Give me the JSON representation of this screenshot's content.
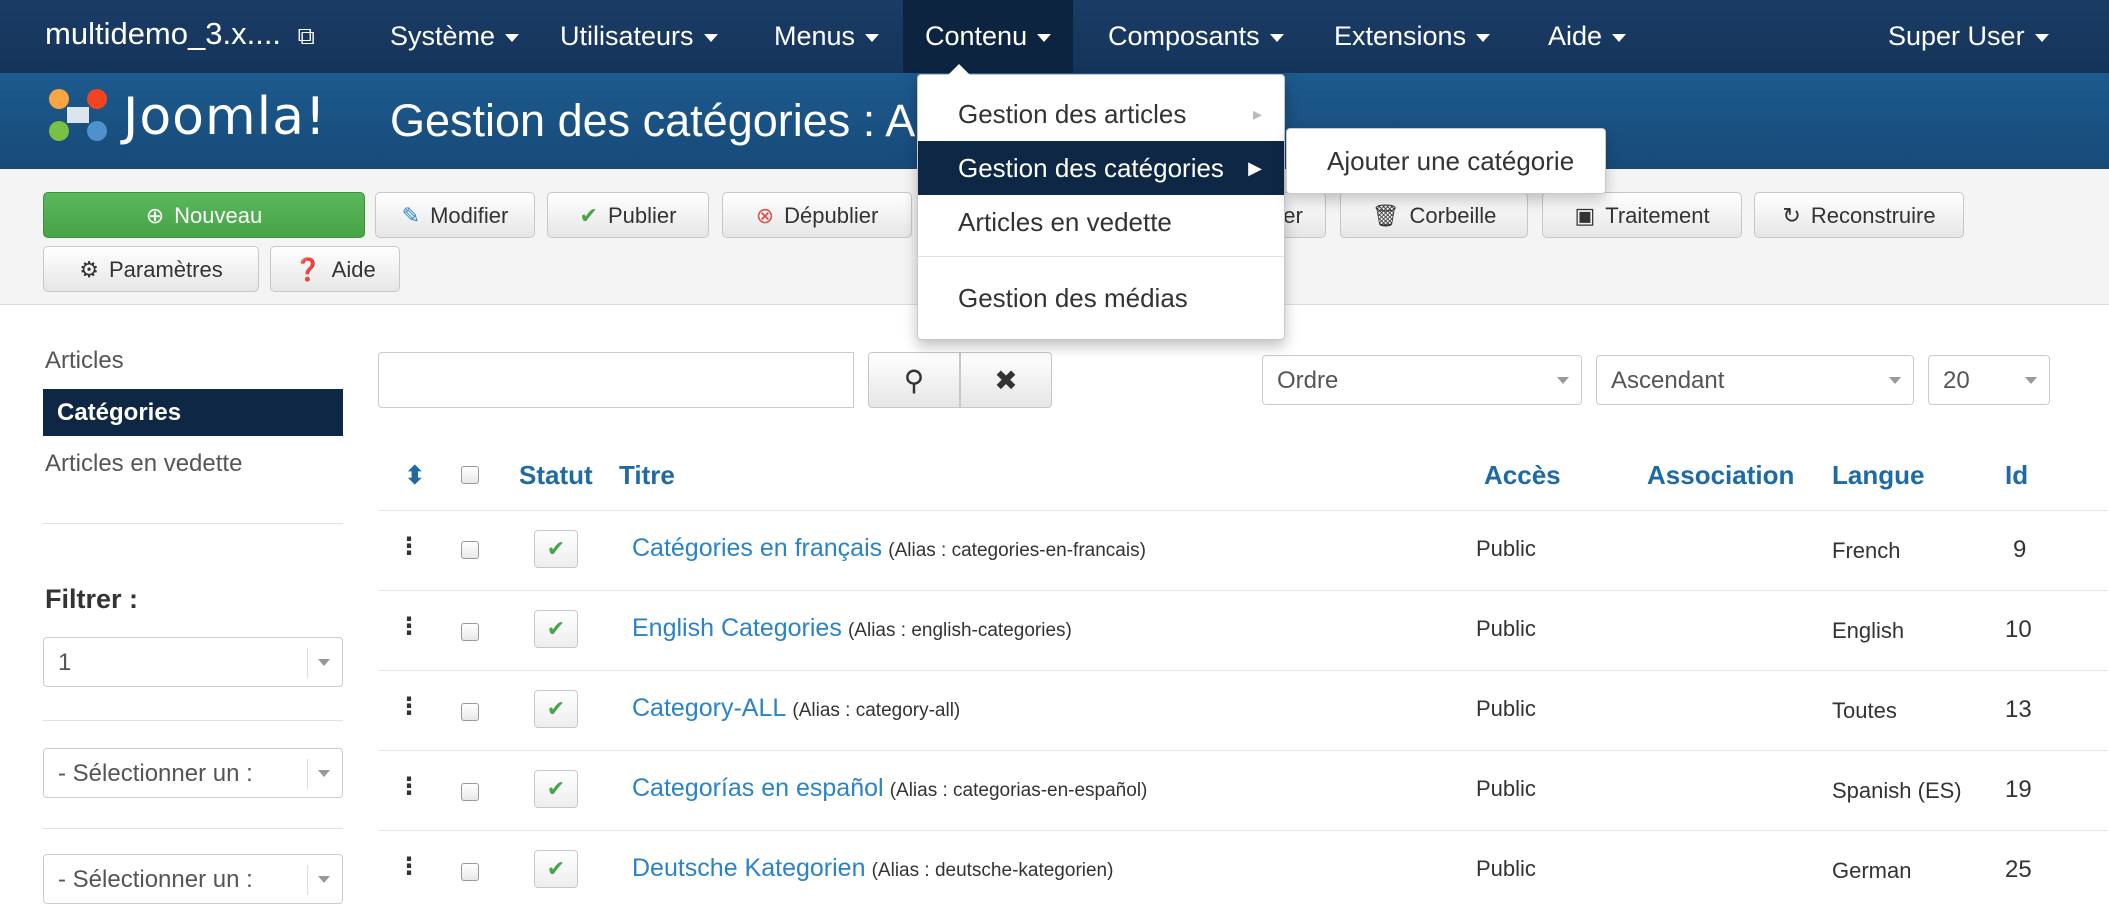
{
  "navbar": {
    "site_name": "multidemo_3.x....",
    "items": [
      {
        "label": "Système"
      },
      {
        "label": "Utilisateurs"
      },
      {
        "label": "Menus"
      },
      {
        "label": "Contenu"
      },
      {
        "label": "Composants"
      },
      {
        "label": "Extensions"
      },
      {
        "label": "Aide"
      }
    ],
    "user": "Super User"
  },
  "header": {
    "logo_text": "Joomla!",
    "title": "Gestion des catégories : Art"
  },
  "toolbar": {
    "new_label": "Nouveau",
    "edit_label": "Modifier",
    "publish_label": "Publier",
    "unpublish_label": "Dépublier",
    "partial_label": "er",
    "trash_label": "Corbeille",
    "batch_label": "Traitement",
    "rebuild_label": "Reconstruire",
    "options_label": "Paramètres",
    "help_label": "Aide"
  },
  "dropdown": {
    "items": [
      {
        "label": "Gestion des articles"
      },
      {
        "label": "Gestion des catégories"
      },
      {
        "label": "Articles en vedette"
      },
      {
        "label": "Gestion des médias"
      }
    ],
    "submenu": {
      "label": "Ajouter une catégorie"
    }
  },
  "sidebar": {
    "items": [
      {
        "label": "Articles"
      },
      {
        "label": "Catégories"
      },
      {
        "label": "Articles en vedette"
      }
    ],
    "filter_label": "Filtrer :",
    "filters": [
      {
        "value": "1"
      },
      {
        "value": "- Sélectionner un :"
      },
      {
        "value": "- Sélectionner un :"
      }
    ]
  },
  "search": {
    "value": "",
    "sort_field": "Ordre",
    "sort_direction": "Ascendant",
    "limit": "20"
  },
  "table": {
    "headers": {
      "status": "Statut",
      "title": "Titre",
      "access": "Accès",
      "association": "Association",
      "language": "Langue",
      "id": "Id"
    },
    "rows": [
      {
        "title": "Catégories en français",
        "alias": "(Alias : categories-en-francais)",
        "access": "Public",
        "language": "French",
        "id": "9"
      },
      {
        "title": "English Categories",
        "alias": "(Alias : english-categories)",
        "access": "Public",
        "language": "English",
        "id": "10"
      },
      {
        "title": "Category-ALL",
        "alias": "(Alias : category-all)",
        "access": "Public",
        "language": "Toutes",
        "id": "13"
      },
      {
        "title": "Categorías en español",
        "alias": "(Alias : categorias-en-español)",
        "access": "Public",
        "language": "Spanish (ES)",
        "id": "19"
      },
      {
        "title": "Deutsche Kategorien",
        "alias": "(Alias : deutsche-kategorien)",
        "access": "Public",
        "language": "German",
        "id": "25"
      }
    ]
  },
  "colors": {
    "navbar": "#16365c",
    "header": "#1c5485",
    "accent": "#1f6aa5",
    "green": "#5bb75b",
    "active": "#0e2744"
  }
}
